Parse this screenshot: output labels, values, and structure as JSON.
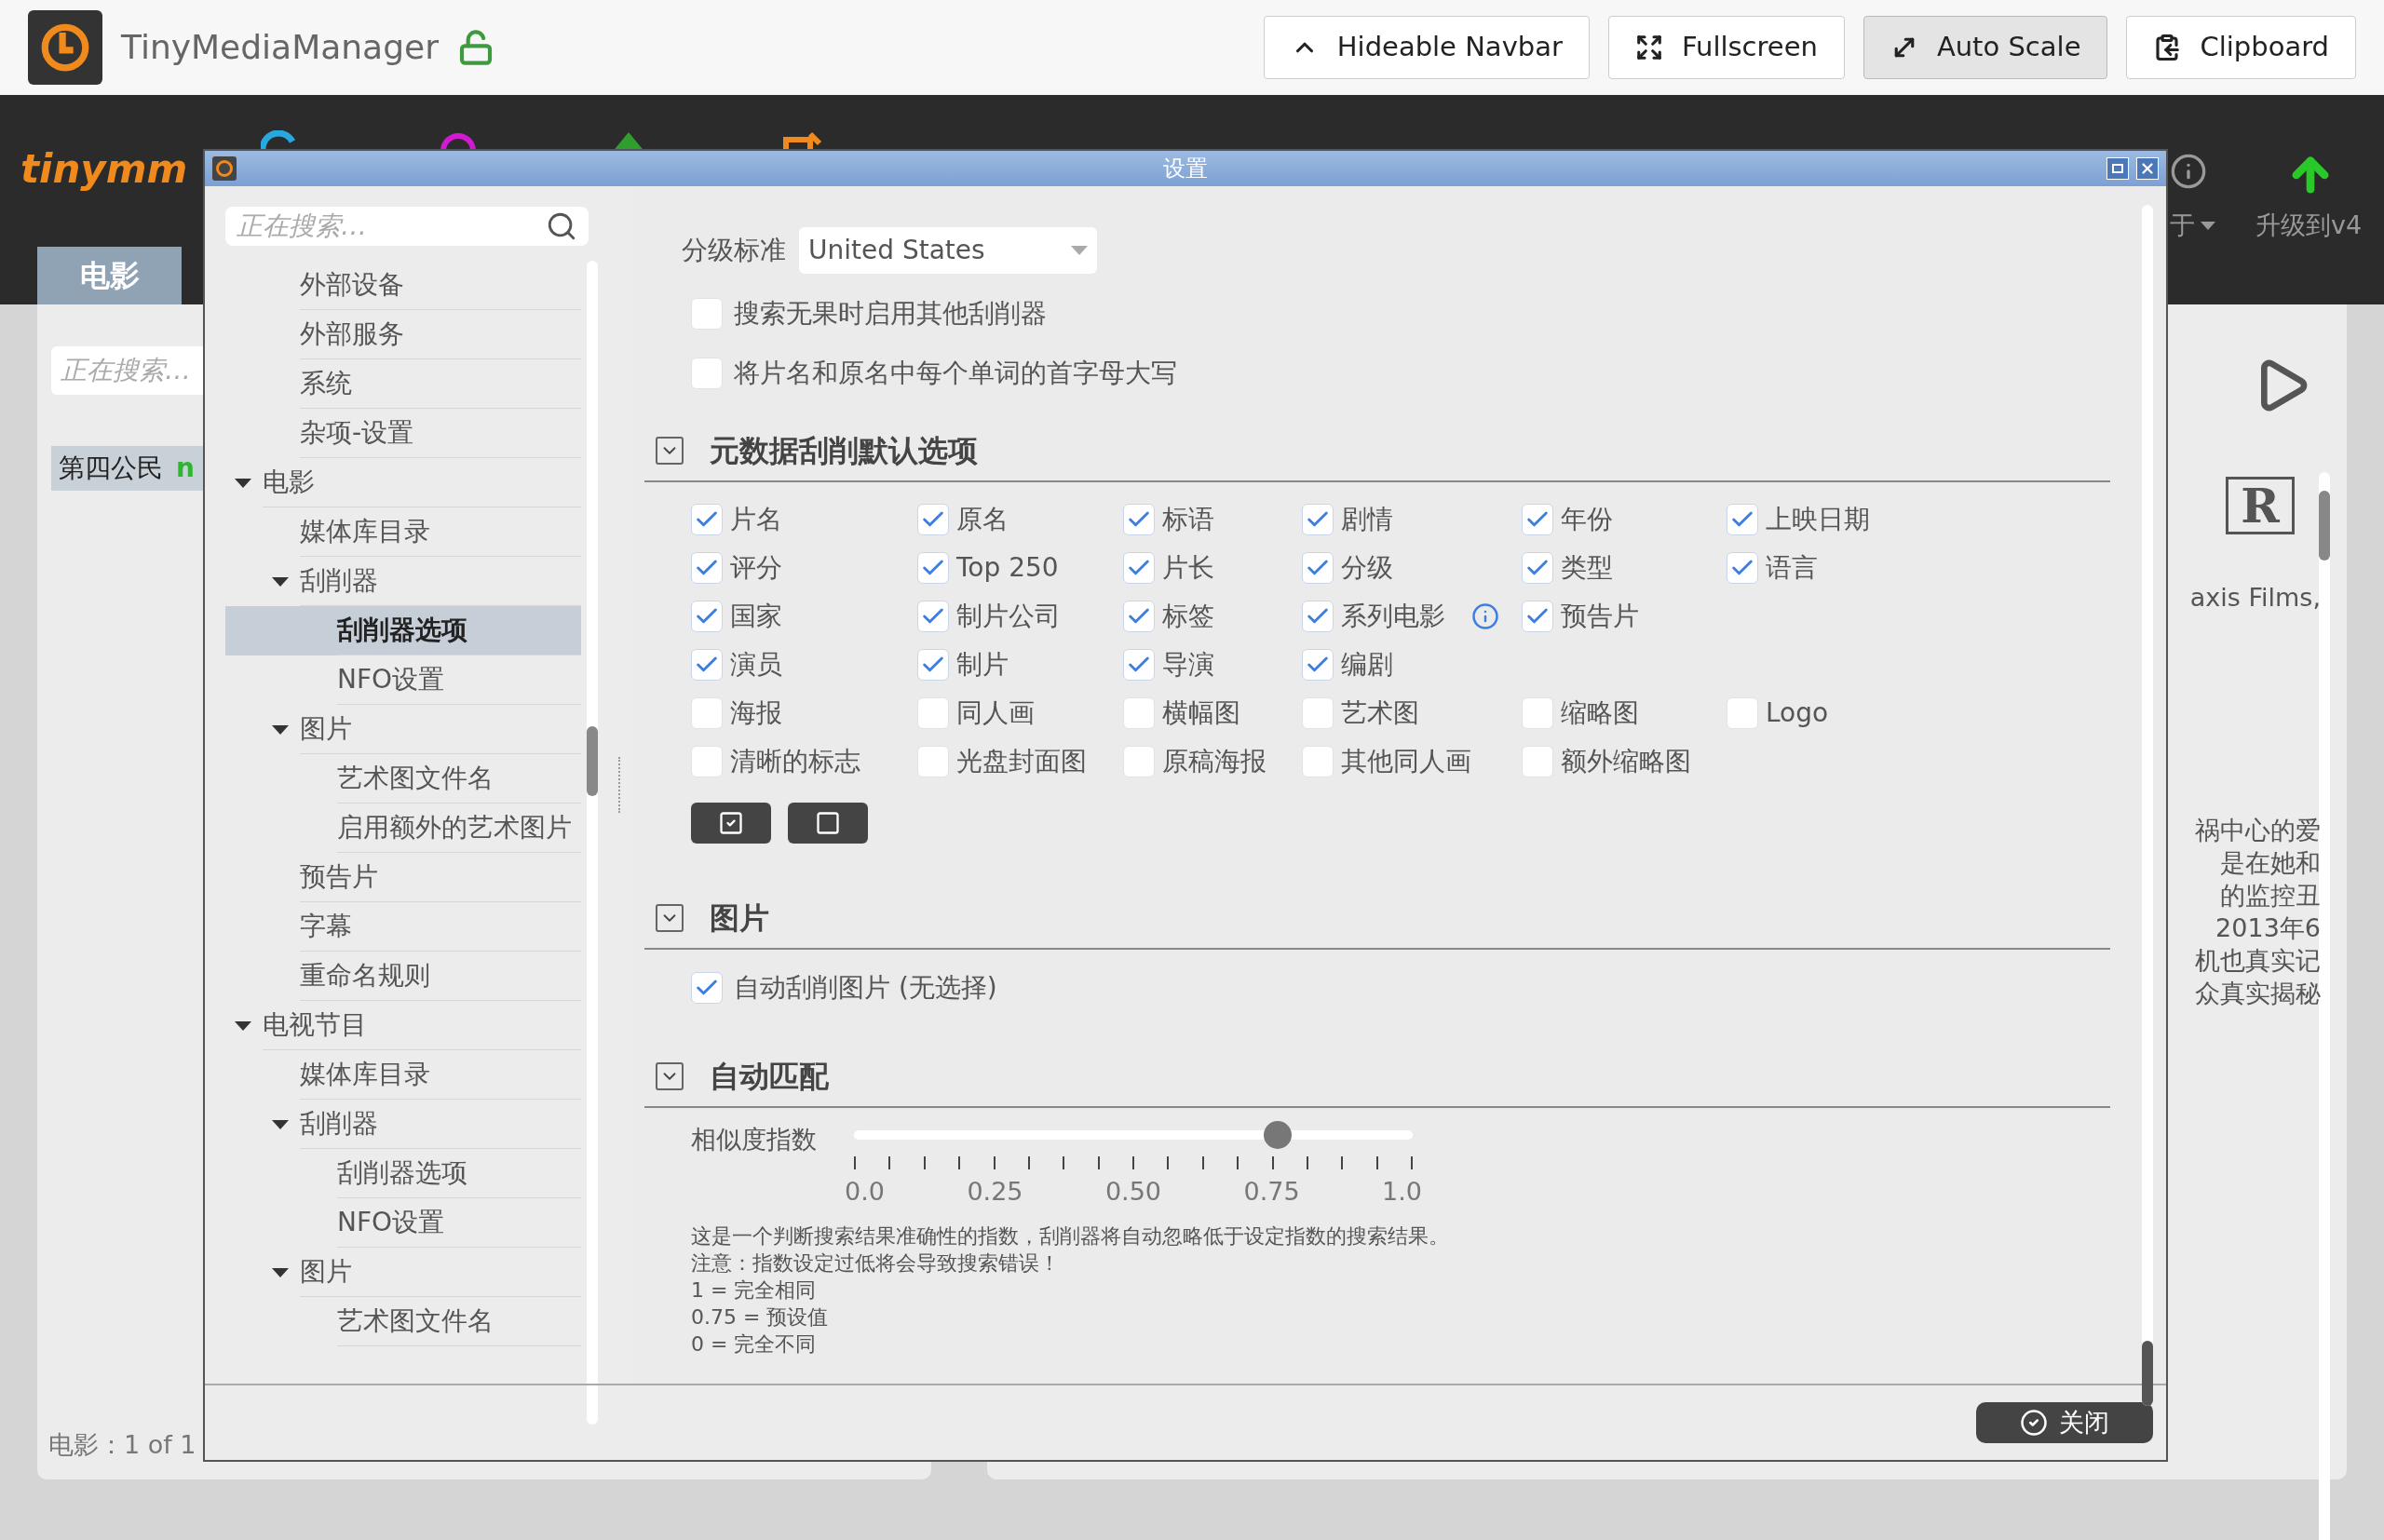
{
  "browser_bar": {
    "title": "TinyMediaManager",
    "buttons": [
      {
        "kind": "navbar",
        "label": "Hideable Navbar",
        "pressed": false
      },
      {
        "kind": "fullscreen",
        "label": "Fullscreen",
        "pressed": false
      },
      {
        "kind": "scale",
        "label": "Auto Scale",
        "pressed": true
      },
      {
        "kind": "clipboard",
        "label": "Clipboard",
        "pressed": false
      }
    ]
  },
  "app": {
    "logo": "tinymm",
    "about_menu": "于",
    "upgrade": "升级到v4",
    "tabs": [
      {
        "label": "电影",
        "selected": true
      }
    ],
    "search": {
      "placeholder": "正在搜索…"
    },
    "movies": [
      {
        "title": "第四公民",
        "badge": "n",
        "selected": true
      }
    ],
    "status": "电影：1 of 1",
    "rating_badge": "R",
    "detail_texts": [
      "axis Films,",
      "祸中心的爱",
      "是在她和",
      "的监控丑",
      "2013年6",
      "机也真实记",
      "众真实揭秘"
    ]
  },
  "dialog": {
    "title": "设置",
    "search": {
      "placeholder": "正在搜索…"
    },
    "tree": [
      {
        "label": "外部设备",
        "kind": "continued",
        "selected": false
      },
      {
        "label": "外部服务",
        "kind": "continued",
        "selected": false
      },
      {
        "label": "系统",
        "kind": "continued",
        "selected": false
      },
      {
        "label": "杂项-设置",
        "kind": "continued",
        "selected": false
      },
      {
        "label": "电影",
        "selected": false,
        "expanded": true,
        "children": [
          {
            "label": "媒体库目录",
            "selected": false
          },
          {
            "label": "刮削器",
            "selected": false,
            "expanded": true,
            "children": [
              {
                "label": "刮削器选项",
                "selected": true
              },
              {
                "label": "NFO设置",
                "selected": false
              }
            ]
          },
          {
            "label": "图片",
            "selected": false,
            "expanded": true,
            "children": [
              {
                "label": "艺术图文件名",
                "selected": false
              },
              {
                "label": "启用额外的艺术图片",
                "selected": false
              }
            ]
          },
          {
            "label": "预告片",
            "selected": false
          },
          {
            "label": "字幕",
            "selected": false
          },
          {
            "label": "重命名规则",
            "selected": false
          }
        ]
      },
      {
        "label": "电视节目",
        "selected": false,
        "expanded": true,
        "children": [
          {
            "label": "媒体库目录",
            "selected": false
          },
          {
            "label": "刮削器",
            "selected": false,
            "expanded": true,
            "children": [
              {
                "label": "刮削器选项",
                "selected": false
              },
              {
                "label": "NFO设置",
                "selected": false
              }
            ]
          },
          {
            "label": "图片",
            "selected": false,
            "expanded": true,
            "children": [
              {
                "label": "艺术图文件名",
                "selected": false
              }
            ]
          }
        ]
      }
    ],
    "rating": {
      "label": "分级标准",
      "value": "United States"
    },
    "options": [
      {
        "label": "搜索无果时启用其他刮削器",
        "checked": false
      },
      {
        "label": "将片名和原名中每个单词的首字母大写",
        "checked": false
      }
    ],
    "metadata_section": {
      "title": "元数据刮削默认选项",
      "expanded": true,
      "fields": [
        {
          "label": "片名",
          "checked": true
        },
        {
          "label": "原名",
          "checked": true
        },
        {
          "label": "标语",
          "checked": true
        },
        {
          "label": "剧情",
          "checked": true
        },
        {
          "label": "年份",
          "checked": true
        },
        {
          "label": "上映日期",
          "checked": true
        },
        {
          "label": "评分",
          "checked": true
        },
        {
          "label": "Top 250",
          "checked": true
        },
        {
          "label": "片长",
          "checked": true
        },
        {
          "label": "分级",
          "checked": true
        },
        {
          "label": "类型",
          "checked": true
        },
        {
          "label": "语言",
          "checked": true
        },
        {
          "label": "国家",
          "checked": true
        },
        {
          "label": "制片公司",
          "checked": true
        },
        {
          "label": "标签",
          "checked": true
        },
        {
          "label": "系列电影",
          "checked": true,
          "info": true
        },
        {
          "label": "预告片",
          "checked": true
        },
        {
          "kind": "empty"
        },
        {
          "label": "演员",
          "checked": true
        },
        {
          "label": "制片",
          "checked": true
        },
        {
          "label": "导演",
          "checked": true
        },
        {
          "label": "编剧",
          "checked": true
        },
        {
          "kind": "empty"
        },
        {
          "kind": "empty"
        },
        {
          "label": "海报",
          "checked": false
        },
        {
          "label": "同人画",
          "checked": false
        },
        {
          "label": "横幅图",
          "checked": false
        },
        {
          "label": "艺术图",
          "checked": false
        },
        {
          "label": "缩略图",
          "checked": false
        },
        {
          "label": "Logo",
          "checked": false
        },
        {
          "label": "清晰的标志",
          "checked": false
        },
        {
          "label": "光盘封面图",
          "checked": false
        },
        {
          "label": "原稿海报",
          "checked": false
        },
        {
          "label": "其他同人画",
          "checked": false
        },
        {
          "label": "额外缩略图",
          "checked": false
        }
      ]
    },
    "artwork_section": {
      "title": "图片",
      "expanded": true,
      "option": {
        "label": "自动刮削图片 (无选择)",
        "checked": true
      }
    },
    "match_section": {
      "title": "自动匹配",
      "expanded": true,
      "slider": {
        "label": "相似度指数",
        "level": 0.75,
        "tick_labels": [
          "0.0",
          "0.25",
          "0.50",
          "0.75",
          "1.0"
        ]
      },
      "notes": [
        "这是一个判断搜索结果准确性的指数，刮削器将自动忽略低于设定指数的搜索结果。",
        "注意：指数设定过低将会导致搜索错误！",
        "1 = 完全相同",
        "0.75 = 预设值",
        "0 = 完全不同"
      ]
    },
    "close_button": "关闭"
  }
}
